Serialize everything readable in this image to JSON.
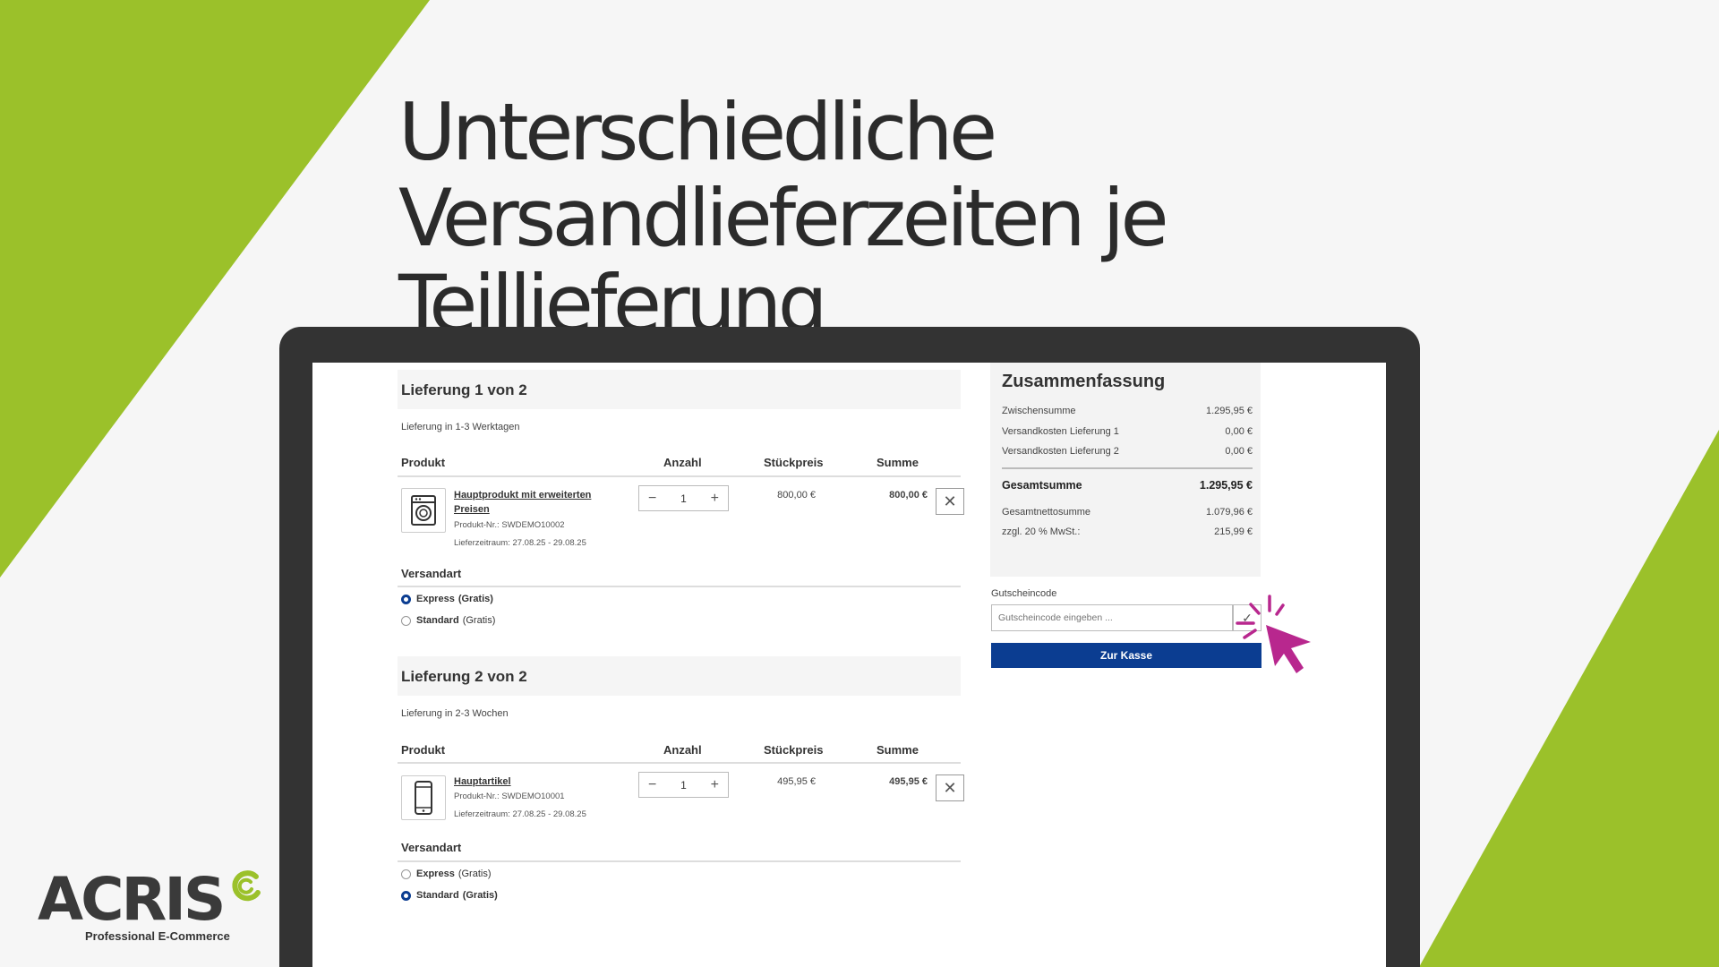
{
  "colors": {
    "accent_green": "#9bc12a",
    "checkout_blue": "#0b3d91",
    "cursor_magenta": "#b8278e"
  },
  "headline": {
    "line1": "Unterschiedliche Versandlieferzeiten je",
    "line2": "Teillieferung"
  },
  "columns": {
    "product": "Produkt",
    "qty": "Anzahl",
    "unit_price": "Stückpreis",
    "total": "Summe"
  },
  "shipping_label": "Versandart",
  "deliveries": [
    {
      "title": "Lieferung 1 von 2",
      "lead_time": "Lieferung in 1-3 Werktagen",
      "product": {
        "icon": "washing-machine-icon",
        "name": "Hauptprodukt mit erweiterten Preisen",
        "sku": "Produkt-Nr.: SWDEMO10002",
        "period": "Lieferzeitraum: 27.08.25 - 29.08.25",
        "qty": "1",
        "unit_price": "800,00 €",
        "total": "800,00 €"
      },
      "options": [
        {
          "name": "Express",
          "note": "(Gratis)",
          "selected": true
        },
        {
          "name": "Standard",
          "note": "(Gratis)",
          "selected": false
        }
      ]
    },
    {
      "title": "Lieferung 2 von 2",
      "lead_time": "Lieferung in 2-3 Wochen",
      "product": {
        "icon": "smartphone-icon",
        "name": "Hauptartikel",
        "sku": "Produkt-Nr.: SWDEMO10001",
        "period": "Lieferzeitraum: 27.08.25 - 29.08.25",
        "qty": "1",
        "unit_price": "495,95 €",
        "total": "495,95 €"
      },
      "options": [
        {
          "name": "Express",
          "note": "(Gratis)",
          "selected": false
        },
        {
          "name": "Standard",
          "note": "(Gratis)",
          "selected": true
        }
      ]
    }
  ],
  "summary": {
    "title": "Zusammenfassung",
    "rows": [
      {
        "label": "Zwischensumme",
        "value": "1.295,95 €"
      },
      {
        "label": "Versandkosten Lieferung 1",
        "value": "0,00 €"
      },
      {
        "label": "Versandkosten Lieferung 2",
        "value": "0,00 €"
      }
    ],
    "grand_total": {
      "label": "Gesamtsumme",
      "value": "1.295,95 €"
    },
    "net_rows": [
      {
        "label": "Gesamtnettosumme",
        "value": "1.079,96 €"
      },
      {
        "label": "zzgl. 20 % MwSt.:",
        "value": "215,99 €"
      }
    ]
  },
  "coupon": {
    "label": "Gutscheincode",
    "placeholder": "Gutscheincode eingeben ..."
  },
  "checkout_label": "Zur Kasse",
  "logo": {
    "word": "ACRIS",
    "tagline": "Professional E-Commerce"
  }
}
